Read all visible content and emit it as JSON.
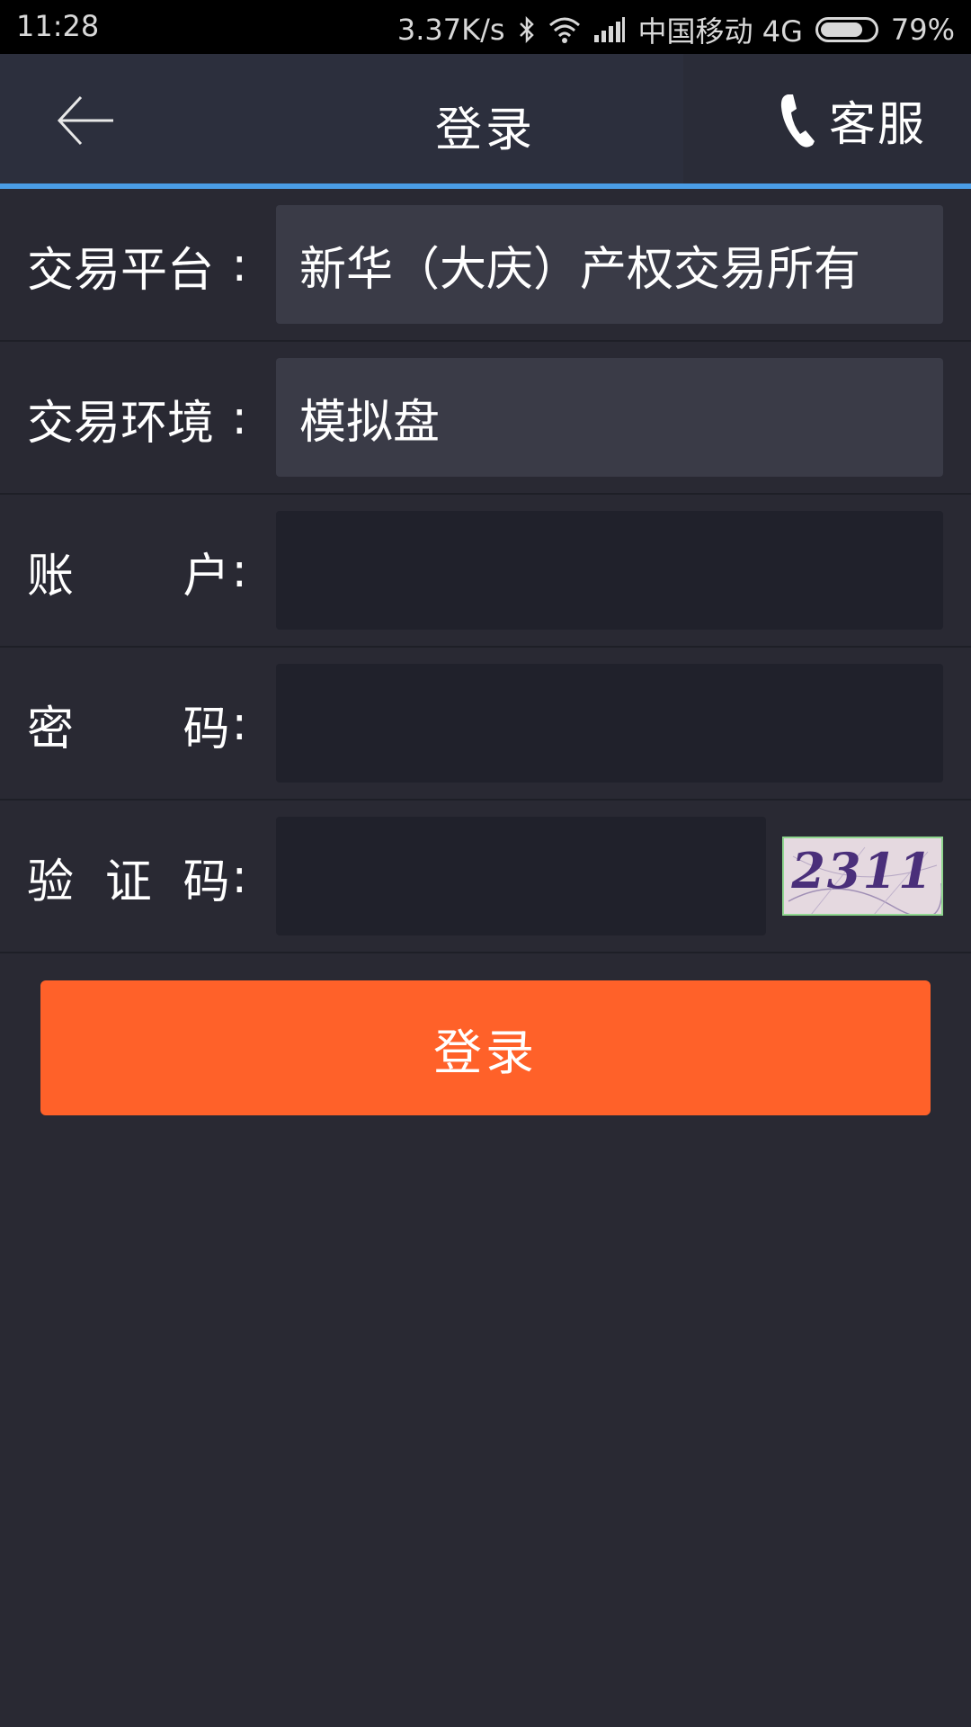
{
  "status_bar": {
    "time": "11:28",
    "network_speed": "3.37K/s",
    "carrier": "中国移动 4G",
    "battery_percent": "79%",
    "battery_level": 0.79
  },
  "header": {
    "title": "登录",
    "back_icon": "back-arrow-icon",
    "service_label": "客服",
    "service_icon": "phone-icon"
  },
  "form": {
    "platform": {
      "label": "交易平台",
      "colon": ":",
      "value": "新华（大庆）产权交易所有"
    },
    "environment": {
      "label": "交易环境",
      "colon": ":",
      "value": "模拟盘"
    },
    "account": {
      "label_chars": [
        "账",
        "户"
      ],
      "colon": ":",
      "value": ""
    },
    "password": {
      "label_chars": [
        "密",
        "码"
      ],
      "colon": ":",
      "value": ""
    },
    "captcha": {
      "label_chars": [
        "验",
        "证",
        "码"
      ],
      "colon": ":",
      "value": "",
      "image_text": "2311"
    }
  },
  "login_button": {
    "label": "登录"
  },
  "colors": {
    "background": "#292933",
    "header": "#2c2f3d",
    "accent_line": "#4a9de6",
    "login_button": "#ff6129",
    "readonly_field": "#3a3b47",
    "input_field": "#20212b"
  }
}
